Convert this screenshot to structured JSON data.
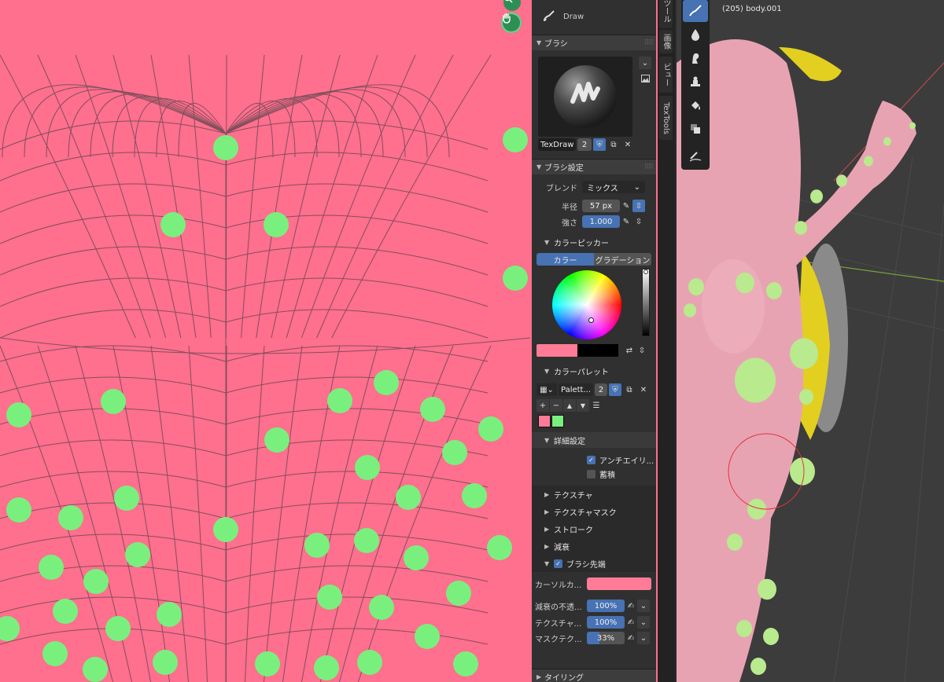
{
  "toolbar_header": {
    "tool_name": "Draw"
  },
  "brush_section": {
    "title": "ブラシ",
    "brush_name": "TexDraw",
    "users": "2"
  },
  "brush_settings": {
    "title": "ブラシ設定",
    "blend_label": "ブレンド",
    "blend_value": "ミックス",
    "radius_label": "半径",
    "radius_value": "57 px",
    "strength_label": "強さ",
    "strength_value": "1.000"
  },
  "color_picker": {
    "title": "カラーピッカー",
    "tab_color": "カラー",
    "tab_gradient": "グラデーション",
    "primary": "#ff7b96",
    "secondary": "#000000"
  },
  "color_palette": {
    "title": "カラーパレット",
    "palette_name": "Palett...",
    "users": "2",
    "swatches": [
      "#ff7b96",
      "#79f07d"
    ]
  },
  "advanced": {
    "title": "詳細設定",
    "antialias_label": "アンチエイリ...",
    "accumulate_label": "蓄積"
  },
  "collapsed_sections": [
    "テクスチャ",
    "テクスチャマスク",
    "ストローク",
    "減衰"
  ],
  "brush_tip": {
    "title": "ブラシ先端",
    "cursor_color_label": "カーソルカ...",
    "falloff_opacity_label": "減衰の不透...",
    "falloff_opacity_value": "100%",
    "texture_label": "テクスチャ...",
    "texture_value": "100%",
    "mask_texture_label": "マスクテク...",
    "mask_texture_value": "33%"
  },
  "tiling": {
    "title": "タイリング"
  },
  "side_tabs": [
    "ツール",
    "画像",
    "ビュー",
    "TexTools"
  ],
  "viewport": {
    "object_info": "(205) body.001"
  },
  "colors": {
    "uv_background": "#ff6f8e",
    "uv_dot": "#79f07d",
    "accent_blue": "#4772b3",
    "panel_bg": "#303030"
  }
}
